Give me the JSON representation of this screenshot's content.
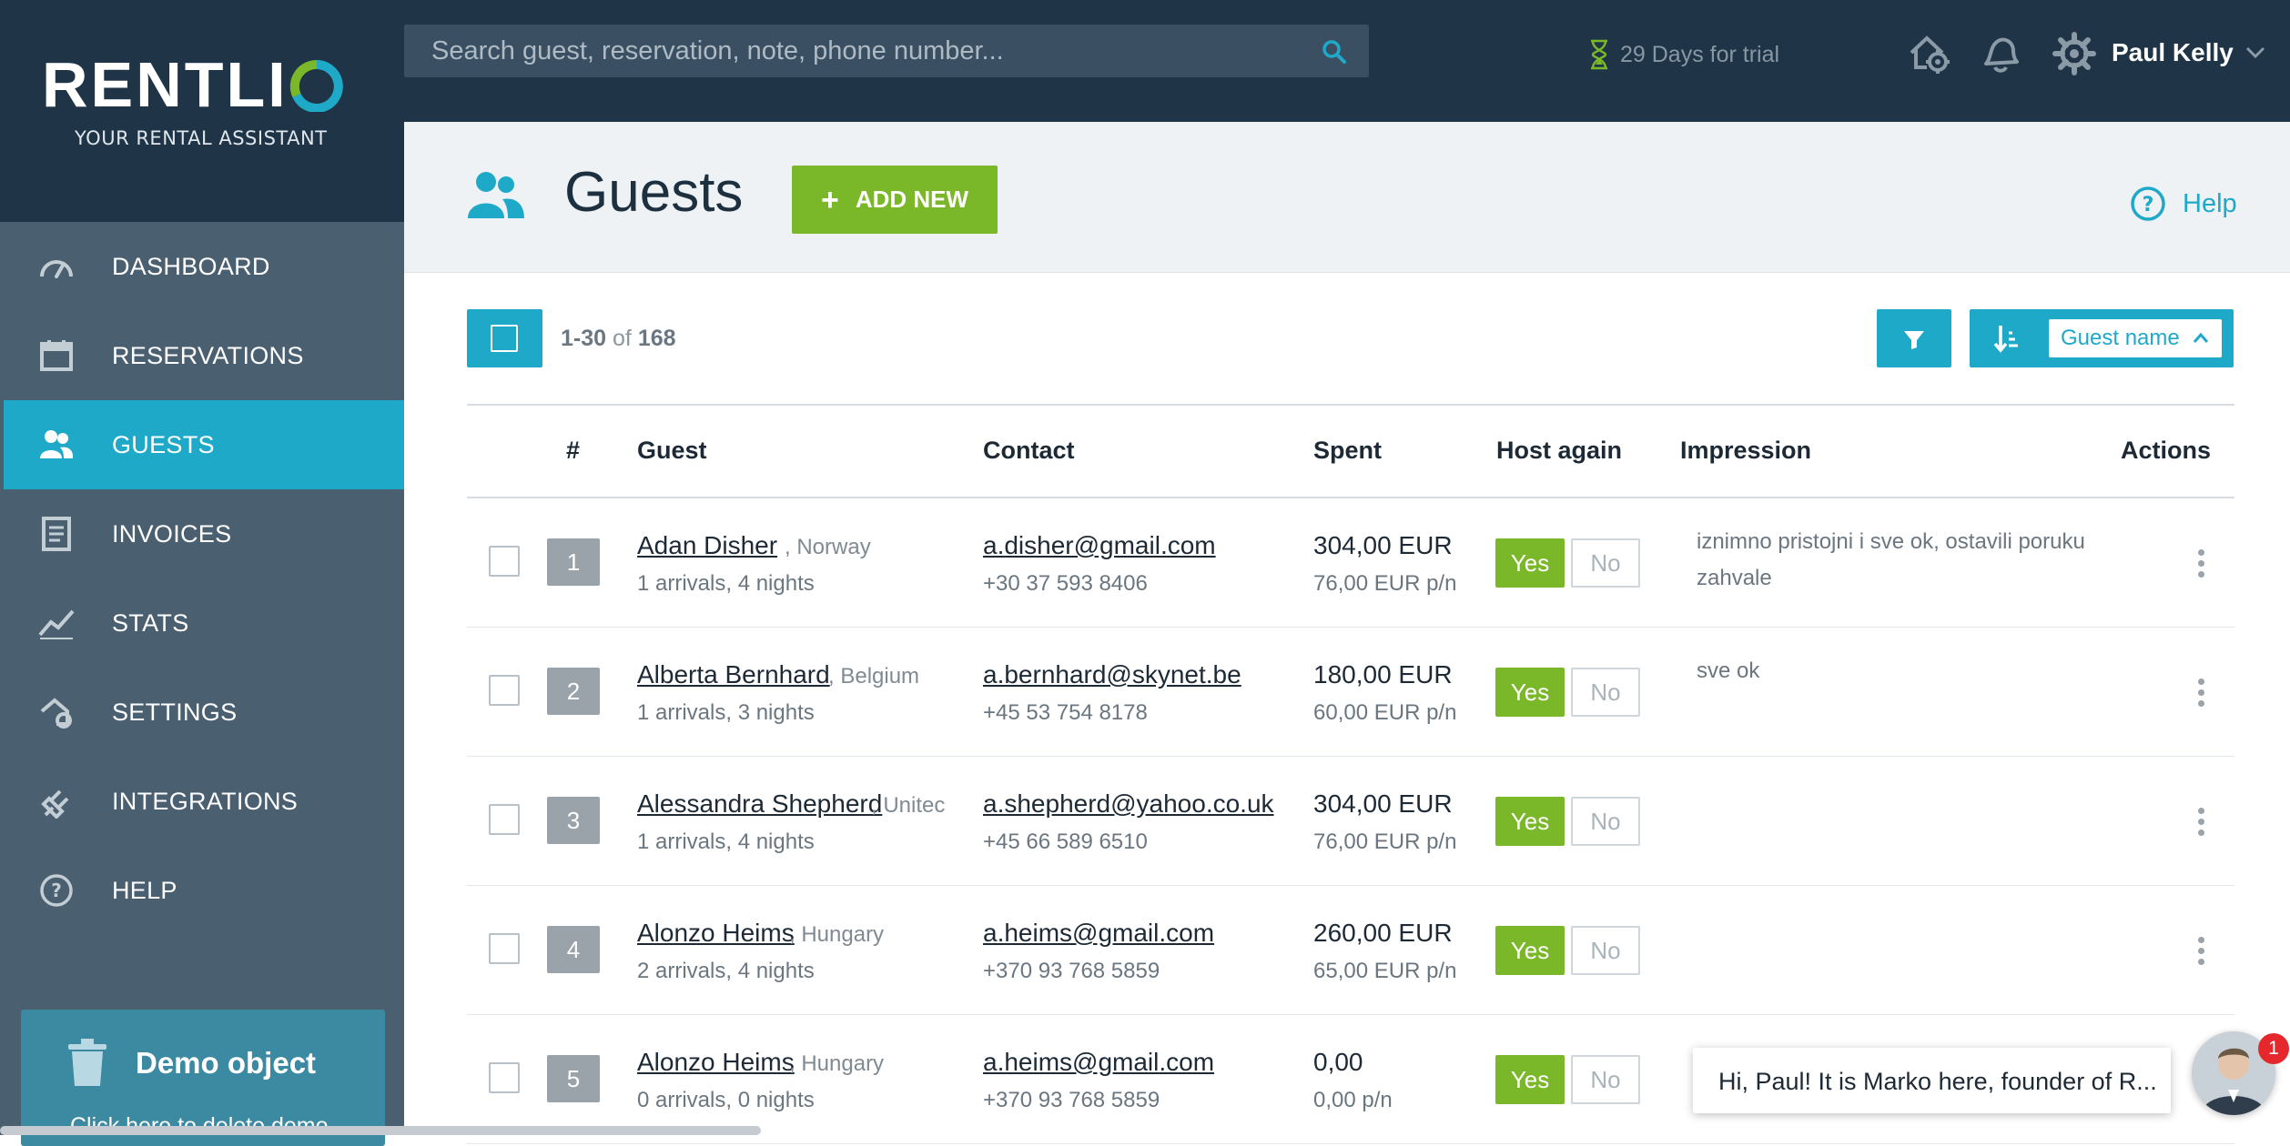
{
  "brand": {
    "name": "RENTLI",
    "tagline": "YOUR RENTAL ASSISTANT"
  },
  "search": {
    "placeholder": "Search guest, reservation, note, phone number..."
  },
  "trial": {
    "text": "29 Days for trial"
  },
  "user": {
    "name": "Paul Kelly"
  },
  "sidebar": {
    "items": [
      {
        "label": "DASHBOARD",
        "icon": "speedometer-icon",
        "active": false
      },
      {
        "label": "RESERVATIONS",
        "icon": "calendar-icon",
        "active": false
      },
      {
        "label": "GUESTS",
        "icon": "users-icon",
        "active": true
      },
      {
        "label": "INVOICES",
        "icon": "invoice-icon",
        "active": false
      },
      {
        "label": "STATS",
        "icon": "chart-line-icon",
        "active": false
      },
      {
        "label": "SETTINGS",
        "icon": "house-gear-icon",
        "active": false
      },
      {
        "label": "INTEGRATIONS",
        "icon": "plug-icon",
        "active": false
      },
      {
        "label": "HELP",
        "icon": "question-icon",
        "active": false
      }
    ],
    "demo": {
      "title": "Demo object",
      "subtitle": "Click here to delete demo"
    }
  },
  "header": {
    "title": "Guests",
    "add_label": "ADD NEW",
    "help_label": "Help"
  },
  "toolbar": {
    "range": "1-30",
    "of": "of",
    "total": "168",
    "sort_label": "Guest name"
  },
  "table": {
    "columns": {
      "num": "#",
      "guest": "Guest",
      "contact": "Contact",
      "spent": "Spent",
      "host_again": "Host again",
      "impression": "Impression",
      "actions": "Actions"
    },
    "rows": [
      {
        "num": "1",
        "name": "Adan Disher",
        "country": "Norway",
        "stats": "1 arrivals, 4 nights",
        "email": "a.disher@gmail.com",
        "phone": "+30 37 593 8406",
        "spent": "304,00 EUR",
        "per": "76,00 EUR p/n",
        "yes": "Yes",
        "no": "No",
        "impression": "iznimno pristojni i sve ok, ostavili poruku zahvale"
      },
      {
        "num": "2",
        "name": "Alberta Bernhard",
        "country": "Belgium",
        "stats": "1 arrivals, 3 nights",
        "email": "a.bernhard@skynet.be",
        "phone": "+45 53 754 8178",
        "spent": "180,00 EUR",
        "per": "60,00 EUR p/n",
        "yes": "Yes",
        "no": "No",
        "impression": "sve ok"
      },
      {
        "num": "3",
        "name": "Alessandra Shepherd",
        "country": "Unitec",
        "stats": "1 arrivals, 4 nights",
        "email": "a.shepherd@yahoo.co.uk",
        "phone": "+45 66 589 6510",
        "spent": "304,00 EUR",
        "per": "76,00 EUR p/n",
        "yes": "Yes",
        "no": "No",
        "impression": ""
      },
      {
        "num": "4",
        "name": "Alonzo Heims",
        "country": "Hungary",
        "stats": "2 arrivals, 4 nights",
        "email": "a.heims@gmail.com",
        "phone": "+370 93 768 5859",
        "spent": "260,00 EUR",
        "per": "65,00 EUR p/n",
        "yes": "Yes",
        "no": "No",
        "impression": ""
      },
      {
        "num": "5",
        "name": "Alonzo Heims",
        "country": "Hungary",
        "stats": "0 arrivals, 0 nights",
        "email": "a.heims@gmail.com",
        "phone": "+370 93 768 5859",
        "spent": "0,00",
        "per": "0,00 p/n",
        "yes": "Yes",
        "no": "No",
        "impression": ""
      }
    ]
  },
  "chat": {
    "message": "Hi, Paul! It is Marko here, founder of R...",
    "badge": "1"
  },
  "colors": {
    "accent": "#1fa9c9",
    "green": "#7ab829",
    "dark": "#1f3446",
    "sidebar": "#4a5f70"
  }
}
